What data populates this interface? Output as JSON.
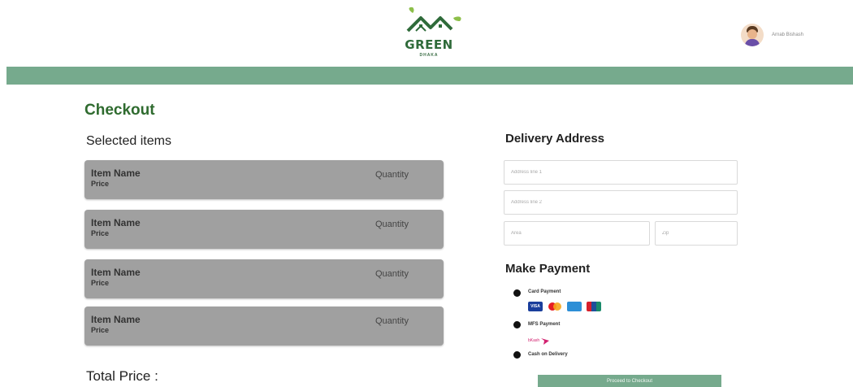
{
  "brand": {
    "logo_text": "GREEN",
    "logo_sub": "DHAKA",
    "accent_color": "#76aa8d",
    "title_color": "#2f6b2f"
  },
  "user": {
    "name": "Arnab Bishash"
  },
  "checkout": {
    "title": "Checkout",
    "selected_label": "Selected items",
    "items": [
      {
        "name": "Item Name",
        "price": "Price",
        "quantity": "Quantity"
      },
      {
        "name": "Item Name",
        "price": "Price",
        "quantity": "Quantity"
      },
      {
        "name": "Item Name",
        "price": "Price",
        "quantity": "Quantity"
      },
      {
        "name": "Item Name",
        "price": "Price",
        "quantity": "Quantity"
      }
    ],
    "total_label": "Total Price :"
  },
  "delivery": {
    "title": "Delivery Address",
    "address1_placeholder": "Address line 1",
    "address2_placeholder": "Address line 2",
    "area_placeholder": "Area",
    "zip_placeholder": "Zip"
  },
  "payment": {
    "title": "Make Payment",
    "options": [
      {
        "label": "Card Payment"
      },
      {
        "label": "MFS Payment"
      },
      {
        "label": "Cash on Delivery"
      }
    ],
    "card_logos": [
      "VISA",
      "mastercard-icon",
      "amex-icon",
      "unionpay-icon"
    ],
    "mfs_logo_text": "bKash"
  },
  "actions": {
    "checkout_label": "Proceed to Checkout"
  }
}
